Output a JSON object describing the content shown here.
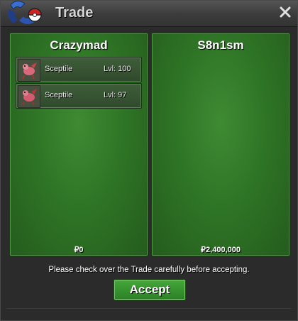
{
  "window": {
    "title": "Trade",
    "close_icon": "close-icon",
    "logo_icon": "pokeball-logo-icon"
  },
  "left": {
    "trainer": "Crazymad",
    "pokemon": [
      {
        "name": "Sceptile",
        "level": "Lvl: 100",
        "sprite_icon": "sceptile-sprite-icon"
      },
      {
        "name": "Sceptile",
        "level": "Lvl: 97",
        "sprite_icon": "sceptile-sprite-icon"
      }
    ],
    "money": "₽0"
  },
  "right": {
    "trainer": "S8n1sm",
    "pokemon": [],
    "money": "₽2,400,000"
  },
  "note": "Please check over the Trade carefully before accepting.",
  "accept_label": "Accept",
  "colors": {
    "panel_green": "#2f7526",
    "accept_green": "#3a9a30",
    "titlebar": "#3d3d3d"
  }
}
